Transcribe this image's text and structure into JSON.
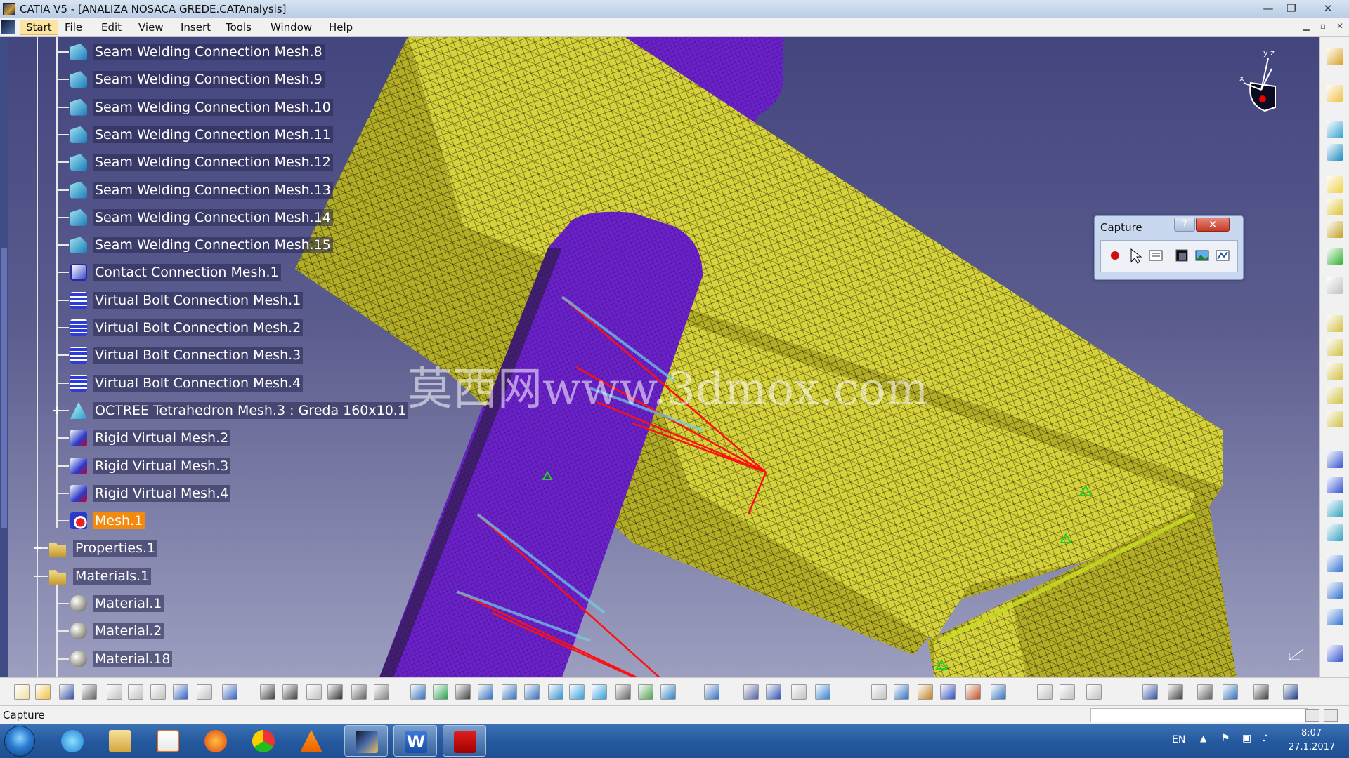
{
  "window": {
    "title": "CATIA V5 - [ANALIZA NOSACA GREDE.CATAnalysis]",
    "minimize": "—",
    "restore": "❐",
    "close": "✕"
  },
  "menu": {
    "items": [
      "Start",
      "File",
      "Edit",
      "View",
      "Insert",
      "Tools",
      "Window",
      "Help"
    ]
  },
  "tree": {
    "items": [
      {
        "label": "Seam Welding Connection Mesh.8",
        "icon": "seam-welding-icon"
      },
      {
        "label": "Seam Welding Connection Mesh.9",
        "icon": "seam-welding-icon"
      },
      {
        "label": "Seam Welding Connection Mesh.10",
        "icon": "seam-welding-icon"
      },
      {
        "label": "Seam Welding Connection Mesh.11",
        "icon": "seam-welding-icon"
      },
      {
        "label": "Seam Welding Connection Mesh.12",
        "icon": "seam-welding-icon"
      },
      {
        "label": "Seam Welding Connection Mesh.13",
        "icon": "seam-welding-icon"
      },
      {
        "label": "Seam Welding Connection Mesh.14",
        "icon": "seam-welding-icon"
      },
      {
        "label": "Seam Welding Connection Mesh.15",
        "icon": "seam-welding-icon"
      },
      {
        "label": "Contact Connection Mesh.1",
        "icon": "contact-connection-icon"
      },
      {
        "label": "Virtual Bolt Connection Mesh.1",
        "icon": "virtual-bolt-icon"
      },
      {
        "label": "Virtual Bolt Connection Mesh.2",
        "icon": "virtual-bolt-icon"
      },
      {
        "label": "Virtual Bolt Connection Mesh.3",
        "icon": "virtual-bolt-icon"
      },
      {
        "label": "Virtual Bolt Connection Mesh.4",
        "icon": "virtual-bolt-icon"
      },
      {
        "label": "OCTREE Tetrahedron Mesh.3 : Greda 160x10.1",
        "icon": "octree-mesh-icon"
      },
      {
        "label": "Rigid Virtual Mesh.2",
        "icon": "rigid-virtual-icon"
      },
      {
        "label": "Rigid Virtual Mesh.3",
        "icon": "rigid-virtual-icon"
      },
      {
        "label": "Rigid Virtual Mesh.4",
        "icon": "rigid-virtual-icon"
      },
      {
        "label": "Mesh.1",
        "icon": "mesh-icon",
        "selected": true
      },
      {
        "label": "Properties.1",
        "icon": "properties-folder-icon"
      },
      {
        "label": "Materials.1",
        "icon": "materials-folder-icon"
      },
      {
        "label": "Material.1",
        "icon": "material-icon"
      },
      {
        "label": "Material.2",
        "icon": "material-icon"
      },
      {
        "label": "Material.18",
        "icon": "material-icon"
      }
    ],
    "expander_plus": "+",
    "expander_minus": "−"
  },
  "watermark": "莫西网www.3dmox.com",
  "compass": {
    "x_label": "x",
    "y_label": "y",
    "z_label": "z"
  },
  "capture_dialog": {
    "title": "Capture",
    "help": "?",
    "close": "✕",
    "tools": [
      "record-icon",
      "select-icon",
      "options-icon",
      "capture-mode-icon",
      "image-icon",
      "album-icon"
    ]
  },
  "colors": {
    "mesh_yellow": "#d6d23a",
    "beam_purple": "#6a22c8",
    "selection_orange": "#f28a10",
    "background_top": "#43457e",
    "background_bottom": "#9d9fc0",
    "virtual_bolt_red": "#ff1010"
  },
  "status": {
    "text": "Capture"
  },
  "taskbar": {
    "apps": [
      "internet-explorer-icon",
      "file-explorer-icon",
      "media-player-icon",
      "firefox-icon",
      "chrome-icon",
      "vlc-icon",
      "catia-icon",
      "word-icon",
      "acrobat-icon"
    ],
    "language": "EN",
    "time": "8:07",
    "date": "27.1.2017"
  }
}
